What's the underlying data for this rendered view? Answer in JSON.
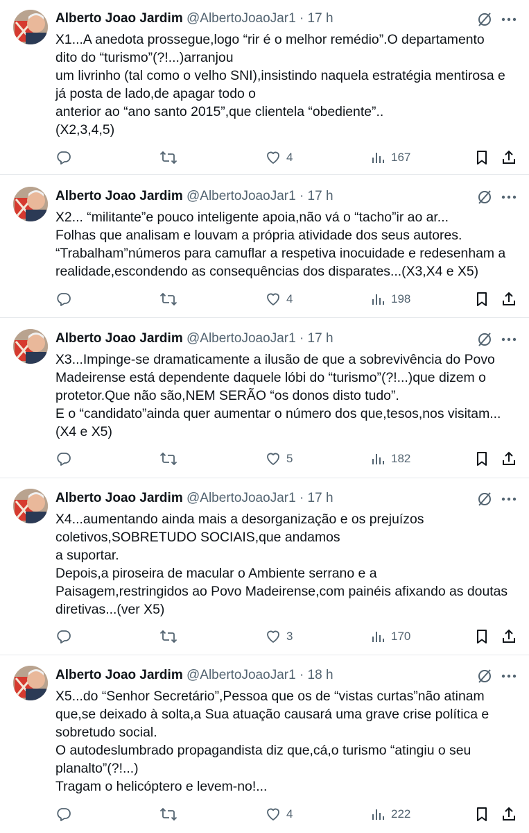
{
  "author": {
    "name": "Alberto Joao Jardim",
    "handle": "@AlbertoJoaoJar1"
  },
  "tweets": [
    {
      "time": "· 17 h",
      "text": "X1...A anedota prossegue,logo “rir é o melhor remédio”.O departamento\ndito do “turismo”(?!...)arranjou\num livrinho (tal como o velho SNI),insistindo naquela estratégia mentirosa e\njá posta de lado,de apagar todo o\nanterior ao “ano santo 2015”,que clientela “obediente”..\n(X2,3,4,5)",
      "likes": "4",
      "views": "167"
    },
    {
      "time": "· 17 h",
      "text": "X2... “militante”e pouco inteligente apoia,não vá o “tacho”ir ao ar...\nFolhas que analisam e louvam a própria atividade dos seus autores.\n“Trabalham”números para camuflar a respetiva inocuidade e redesenham a\nrealidade,escondendo as consequências dos disparates...(X3,X4 e X5)",
      "likes": "4",
      "views": "198"
    },
    {
      "time": "· 17 h",
      "text": "X3...Impinge-se dramaticamente a ilusão de que a sobrevivência do Povo\nMadeirense está dependente daquele lóbi do “turismo”(?!...)que dizem o\nprotetor.Que não são,NEM SERÃO “os donos disto tudo”.\nE o “candidato”ainda quer aumentar o número dos que,tesos,nos visitam...\n(X4 e X5)",
      "likes": "5",
      "views": "182"
    },
    {
      "time": "· 17 h",
      "text": "X4...aumentando ainda mais a desorganização e os prejuízos\ncoletivos,SOBRETUDO SOCIAIS,que andamos\na suportar.\nDepois,a piroseira de macular o Ambiente serrano e a\nPaisagem,restringidos ao Povo Madeirense,com painéis afixando as doutas\ndiretivas...(ver X5)",
      "likes": "3",
      "views": "170"
    },
    {
      "time": "· 18 h",
      "text": "X5...do “Senhor Secretário”,Pessoa que os de “vistas curtas”não atinam\nque,se deixado à solta,a Sua atuação causará uma grave crise política e\nsobretudo social.\nO autodeslumbrado propagandista diz que,cá,o turismo “atingiu o seu\nplanalto”(?!...)\nTragam o helicóptero e levem-no!...",
      "likes": "4",
      "views": "222"
    }
  ],
  "icons": {
    "reply": "reply-icon",
    "retweet": "retweet-icon",
    "like": "heart-icon",
    "views": "views-icon",
    "bookmark": "bookmark-icon",
    "share": "share-icon",
    "grok": "grok-icon",
    "more": "more-icon"
  },
  "colors": {
    "text": "#0f1419",
    "secondary": "#536471",
    "divider": "#e6e9ec"
  }
}
